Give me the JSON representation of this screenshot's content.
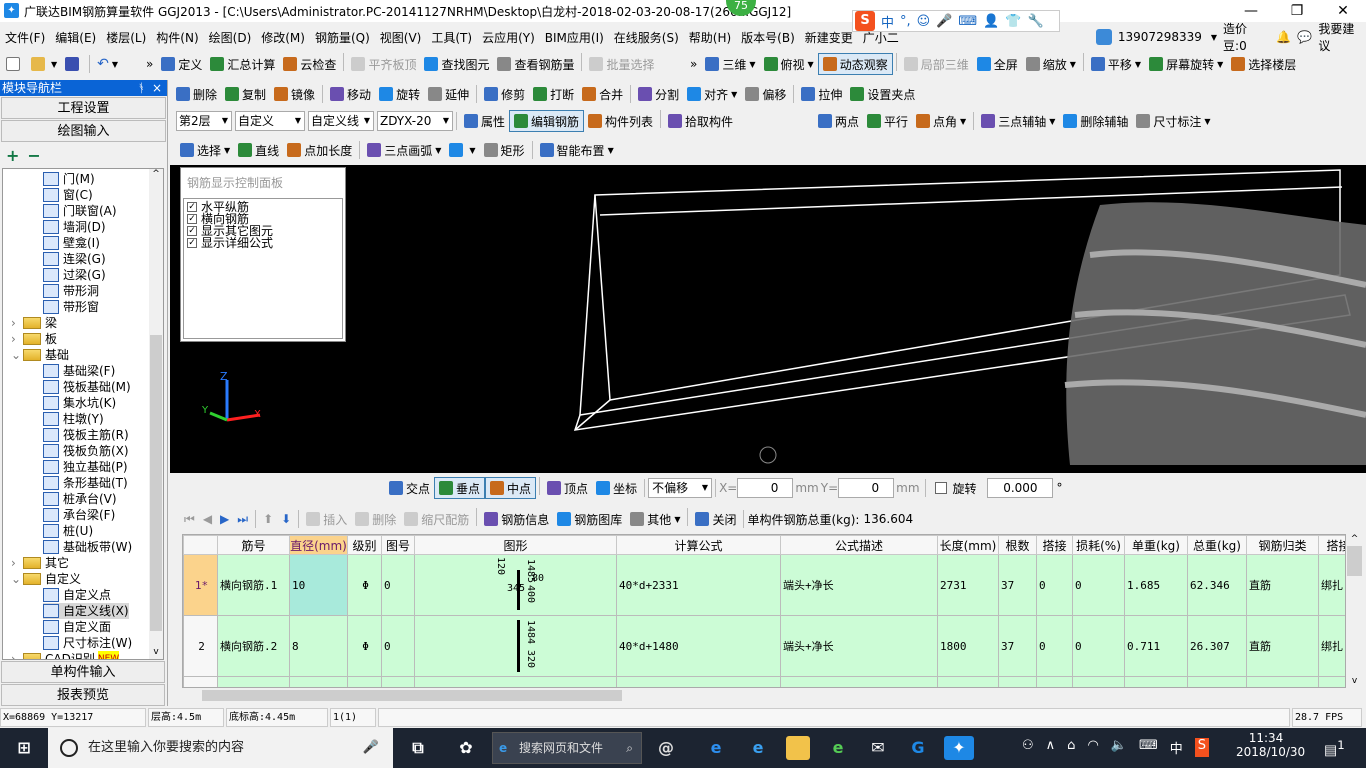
{
  "window": {
    "title": "广联达BIM钢筋算量软件 GGJ2013 - [C:\\Users\\Administrator.PC-20141127NRHM\\Desktop\\白龙村-2018-02-03-20-08-17(266...GGJ12]",
    "badge": "75",
    "minimize": "—",
    "maximize": "❐",
    "close": "✕"
  },
  "ime": {
    "logo": "S",
    "items": [
      "中",
      "°,",
      "☺",
      "🎤",
      "⌨",
      "👤",
      "👕",
      "🔧"
    ]
  },
  "menu": [
    "文件(F)",
    "编辑(E)",
    "楼层(L)",
    "构件(N)",
    "绘图(D)",
    "修改(M)",
    "钢筋量(Q)",
    "视图(V)",
    "工具(T)",
    "云应用(Y)",
    "BIM应用(I)",
    "在线服务(S)",
    "帮助(H)",
    "版本号(B)",
    "新建变更",
    "广小二"
  ],
  "account": {
    "phone": "13907298339",
    "beans": "造价豆:0",
    "suggest": "我要建议"
  },
  "toolbar1": [
    {
      "label": "定义"
    },
    {
      "label": "汇总计算"
    },
    {
      "label": "云检查"
    },
    {
      "label": "平齐板顶",
      "disabled": true
    },
    {
      "label": "查找图元"
    },
    {
      "label": "查看钢筋量"
    },
    {
      "label": "批量选择",
      "disabled": true
    }
  ],
  "toolbar1r": [
    {
      "label": "三维",
      "dd": true
    },
    {
      "label": "俯视",
      "dd": true
    },
    {
      "label": "动态观察",
      "active": true
    },
    {
      "label": "局部三维",
      "disabled": true
    },
    {
      "label": "全屏"
    },
    {
      "label": "缩放",
      "dd": true
    },
    {
      "label": "平移",
      "dd": true
    },
    {
      "label": "屏幕旋转",
      "dd": true
    },
    {
      "label": "选择楼层"
    }
  ],
  "edit_toolbar": [
    {
      "label": "删除"
    },
    {
      "label": "复制"
    },
    {
      "label": "镜像"
    },
    {
      "label": "移动"
    },
    {
      "label": "旋转"
    },
    {
      "label": "延伸"
    },
    {
      "label": "修剪"
    },
    {
      "label": "打断"
    },
    {
      "label": "合并"
    },
    {
      "label": "分割"
    },
    {
      "label": "对齐",
      "dd": true
    },
    {
      "label": "偏移"
    },
    {
      "label": "拉伸"
    },
    {
      "label": "设置夹点"
    }
  ],
  "selectors": [
    {
      "value": "第2层"
    },
    {
      "value": "自定义"
    },
    {
      "value": "自定义线"
    },
    {
      "value": "ZDYX-20"
    }
  ],
  "prop_toolbar": [
    {
      "label": "属性"
    },
    {
      "label": "编辑钢筋",
      "active": true
    },
    {
      "label": "构件列表"
    },
    {
      "label": "拾取构件"
    }
  ],
  "axis_toolbar": [
    {
      "label": "两点"
    },
    {
      "label": "平行"
    },
    {
      "label": "点角",
      "dd": true
    },
    {
      "label": "三点辅轴",
      "dd": true
    },
    {
      "label": "删除辅轴"
    },
    {
      "label": "尺寸标注",
      "dd": true
    }
  ],
  "draw_toolbar": [
    {
      "label": "选择",
      "dd": true
    },
    {
      "label": "直线"
    },
    {
      "label": "点加长度"
    },
    {
      "label": "三点画弧",
      "dd": true
    },
    {
      "label": "",
      "dd": true
    },
    {
      "label": "矩形"
    },
    {
      "label": "智能布置",
      "dd": true
    }
  ],
  "nav": {
    "title": "模块导航栏",
    "pin": "ᚬ",
    "close": "×",
    "project_settings": "工程设置",
    "draw_input": "绘图输入",
    "expand": "+",
    "collapse": "−",
    "single_input": "单构件输入",
    "report_preview": "报表预览",
    "tree": [
      {
        "label": "门(M)",
        "lvl": 2
      },
      {
        "label": "窗(C)",
        "lvl": 2
      },
      {
        "label": "门联窗(A)",
        "lvl": 2
      },
      {
        "label": "墙洞(D)",
        "lvl": 2
      },
      {
        "label": "壁龛(I)",
        "lvl": 2
      },
      {
        "label": "连梁(G)",
        "lvl": 2
      },
      {
        "label": "过梁(G)",
        "lvl": 2
      },
      {
        "label": "带形洞",
        "lvl": 2
      },
      {
        "label": "带形窗",
        "lvl": 2
      },
      {
        "label": "梁",
        "lvl": 1,
        "folder": true,
        "arrow": "›"
      },
      {
        "label": "板",
        "lvl": 1,
        "folder": true,
        "arrow": "›"
      },
      {
        "label": "基础",
        "lvl": 1,
        "folder": true,
        "arrow": "⌄"
      },
      {
        "label": "基础梁(F)",
        "lvl": 2
      },
      {
        "label": "筏板基础(M)",
        "lvl": 2
      },
      {
        "label": "集水坑(K)",
        "lvl": 2
      },
      {
        "label": "柱墩(Y)",
        "lvl": 2
      },
      {
        "label": "筏板主筋(R)",
        "lvl": 2
      },
      {
        "label": "筏板负筋(X)",
        "lvl": 2
      },
      {
        "label": "独立基础(P)",
        "lvl": 2
      },
      {
        "label": "条形基础(T)",
        "lvl": 2
      },
      {
        "label": "桩承台(V)",
        "lvl": 2
      },
      {
        "label": "承台梁(F)",
        "lvl": 2
      },
      {
        "label": "桩(U)",
        "lvl": 2
      },
      {
        "label": "基础板带(W)",
        "lvl": 2
      },
      {
        "label": "其它",
        "lvl": 1,
        "folder": true,
        "arrow": "›"
      },
      {
        "label": "自定义",
        "lvl": 1,
        "folder": true,
        "arrow": "⌄"
      },
      {
        "label": "自定义点",
        "lvl": 2
      },
      {
        "label": "自定义线(X)",
        "lvl": 2,
        "selected": true
      },
      {
        "label": "自定义面",
        "lvl": 2
      },
      {
        "label": "尺寸标注(W)",
        "lvl": 2
      },
      {
        "label": "CAD识别",
        "lvl": 1,
        "folder": true,
        "arrow": "›",
        "badge": "NEW"
      }
    ]
  },
  "control_panel": {
    "title": "钢筋显示控制面板",
    "items": [
      {
        "label": "水平纵筋",
        "checked": true
      },
      {
        "label": "横向钢筋",
        "checked": true
      },
      {
        "label": "显示其它图元",
        "checked": true
      },
      {
        "label": "显示详细公式",
        "checked": true
      }
    ]
  },
  "snap": {
    "items": [
      {
        "label": "交点"
      },
      {
        "label": "垂点",
        "active": true
      },
      {
        "label": "中点",
        "active": true
      },
      {
        "label": "顶点"
      },
      {
        "label": "坐标"
      }
    ],
    "offset": "不偏移",
    "x_label": "X=",
    "x": "0",
    "unit": "mm",
    "y_label": "Y=",
    "y": "0",
    "rotate_label": "旋转",
    "rotate": "0.000",
    "degree": "°"
  },
  "rebar_toolbar": {
    "items": [
      {
        "label": "插入",
        "disabled": true
      },
      {
        "label": "删除",
        "disabled": true
      },
      {
        "label": "缩尺配筋",
        "disabled": true
      },
      {
        "label": "钢筋信息"
      },
      {
        "label": "钢筋图库"
      },
      {
        "label": "其他",
        "dd": true
      },
      {
        "label": "关闭"
      }
    ],
    "total_label": "单构件钢筋总重(kg):",
    "total": "136.604"
  },
  "table": {
    "columns": [
      "",
      "筋号",
      "直径(mm)",
      "级别",
      "图号",
      "图形",
      "计算公式",
      "公式描述",
      "长度(mm)",
      "根数",
      "搭接",
      "损耗(%)",
      "单重(kg)",
      "总重(kg)",
      "钢筋归类",
      "搭接"
    ],
    "rows": [
      {
        "idx": "1*",
        "name": "横向钢筋.1",
        "dia": "10",
        "grade": "Φ",
        "fig": "0",
        "shape": [
          "120",
          "1485",
          "345",
          "80",
          "400"
        ],
        "formula": "40*d+2331",
        "desc": "端头+净长",
        "len": "2731",
        "count": "37",
        "lap": "0",
        "loss": "0",
        "unit_w": "1.685",
        "total_w": "62.346",
        "type": "直筋",
        "lap_type": "绑扎"
      },
      {
        "idx": "2",
        "name": "横向钢筋.2",
        "dia": "8",
        "grade": "Φ",
        "fig": "0",
        "shape": [
          "1484",
          "320"
        ],
        "formula": "40*d+1480",
        "desc": "端头+净长",
        "len": "1800",
        "count": "37",
        "lap": "0",
        "loss": "0",
        "unit_w": "0.711",
        "total_w": "26.307",
        "type": "直筋",
        "lap_type": "绑扎"
      }
    ]
  },
  "status": {
    "coords": "X=68869 Y=13217",
    "floor_h": "层高:4.5m",
    "bottom_h": "底标高:4.45m",
    "page": "1(1)",
    "fps": "28.7 FPS"
  },
  "taskbar": {
    "search_placeholder": "在这里输入你要搜索的内容",
    "web_search": "搜索网页和文件",
    "time": "11:34",
    "date": "2018/10/30",
    "ime": "中",
    "notif": "1"
  },
  "colors": {
    "accent": "#0a64d6",
    "grid_row": "#ccfcd6",
    "grid_sel_header": "#fbd38c",
    "viewport_bg": "#000000",
    "grid_lines": "#ff0000"
  }
}
